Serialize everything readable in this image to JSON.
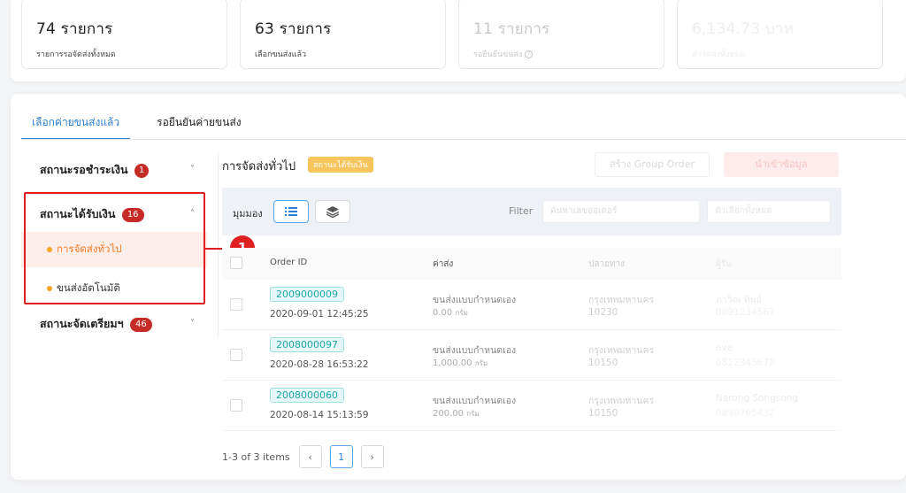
{
  "stats": [
    {
      "value": "74 รายการ",
      "label": "รายการรอจัดส่งทั้งหมด"
    },
    {
      "value": "63 รายการ",
      "label": "เลือกขนส่งแล้ว"
    },
    {
      "value": "11 รายการ",
      "label": "รอยืนยันขนส่ง"
    },
    {
      "value": "6,134.73 บาท",
      "label": "ค่าจัดส่งทั้งหมด"
    }
  ],
  "tabs": [
    "เลือกค่ายขนส่งแล้ว",
    "รอยืนยันค่ายขนส่ง"
  ],
  "sidebar": {
    "groups": [
      {
        "label": "สถานะรอชำระเงิน",
        "badge": "1",
        "chevron": "˅"
      },
      {
        "label": "สถานะได้รับเงิน",
        "badge": "16",
        "chevron": "˄"
      },
      {
        "label": "สถานะจัดเตรียมฯ",
        "badge": "46",
        "chevron": "˅"
      }
    ],
    "subitems": [
      "การจัดส่งทั่วไป",
      "ขนส่งอัตโนมัติ"
    ]
  },
  "annotation": {
    "number": "1",
    "color": "#e02020"
  },
  "content": {
    "title": "การจัดส่งทั่วไป",
    "status_tag": "สถานะได้รับเงิน",
    "btn_group_order": "สร้าง Group Order",
    "btn_red": "นำเข้าข้อมูล"
  },
  "filterbar": {
    "view_label": "มุมมอง",
    "filter_label": "Filter",
    "search_placeholder": "ค้นหาเลขออเดอร์",
    "select_value": "ตัวเลือกทั้งหมด"
  },
  "table": {
    "headers": [
      "Order ID",
      "ค่าส่ง",
      "ปลายทาง",
      "ผู้รับ"
    ],
    "rows": [
      {
        "order_id": "2009000009",
        "date": "2020-09-01 12:45:25",
        "ship_name": "ขนส่งแบบกำหนดเอง",
        "ship_cost": "0.00",
        "unit": "กรัม",
        "dest_city": "กรุงเทพมหานคร",
        "dest_zip": "10230",
        "recv_name": "ภาวิณ ทิพย์",
        "recv_phone": "0891234567"
      },
      {
        "order_id": "2008000097",
        "date": "2020-08-28 16:53:22",
        "ship_name": "ขนส่งแบบกำหนดเอง",
        "ship_cost": "1,000.00",
        "unit": "กรัม",
        "dest_city": "กรุงเทพมหานคร",
        "dest_zip": "10150",
        "recv_name": "eve",
        "recv_phone": "0812345678"
      },
      {
        "order_id": "2008000060",
        "date": "2020-08-14 15:13:59",
        "ship_name": "ขนส่งแบบกำหนดเอง",
        "ship_cost": "200.00",
        "unit": "กรัม",
        "dest_city": "กรุงเทพมหานคร",
        "dest_zip": "10150",
        "recv_name": "Narong Songsong",
        "recv_phone": "0898765432"
      }
    ]
  },
  "pager": {
    "info": "1-3 of 3 items",
    "prev": "‹",
    "page": "1",
    "next": "›"
  },
  "colors": {
    "accent": "#2a7fd3",
    "badge": "#c62b28",
    "active_sub": "#f07a25",
    "order_id": "#1ea6a6"
  }
}
